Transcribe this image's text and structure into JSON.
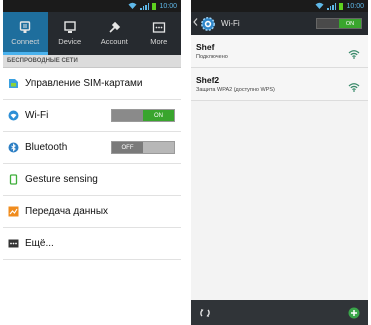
{
  "status_bar": {
    "time": "10:00"
  },
  "left": {
    "tabs": [
      {
        "label": "Connect",
        "icon": "connect-icon",
        "active": true
      },
      {
        "label": "Device",
        "icon": "device-icon",
        "active": false
      },
      {
        "label": "Account",
        "icon": "account-icon",
        "active": false
      },
      {
        "label": "More",
        "icon": "more-icon",
        "active": false
      }
    ],
    "section_header": "БЕСПРОВОДНЫЕ СЕТИ",
    "rows": [
      {
        "label": "Управление SIM-картами",
        "icon": "sim-card-icon"
      },
      {
        "label": "Wi-Fi",
        "icon": "wifi-icon",
        "toggle": "ON"
      },
      {
        "label": "Bluetooth",
        "icon": "bluetooth-icon",
        "toggle": "OFF"
      },
      {
        "label": "Gesture sensing",
        "icon": "gesture-icon"
      },
      {
        "label": "Передача данных",
        "icon": "data-usage-icon"
      },
      {
        "label": "Ещё...",
        "icon": "more-options-icon"
      }
    ]
  },
  "right": {
    "title": "Wi-Fi",
    "toggle": "ON",
    "networks": [
      {
        "name": "Shef",
        "status": "Подключено"
      },
      {
        "name": "Shef2",
        "status": "Защита WPA2 (доступно WPS)"
      }
    ]
  },
  "colors": {
    "accent": "#1e6e9d",
    "toggle_on": "#39a52d",
    "header_bg": "#262a2f"
  }
}
